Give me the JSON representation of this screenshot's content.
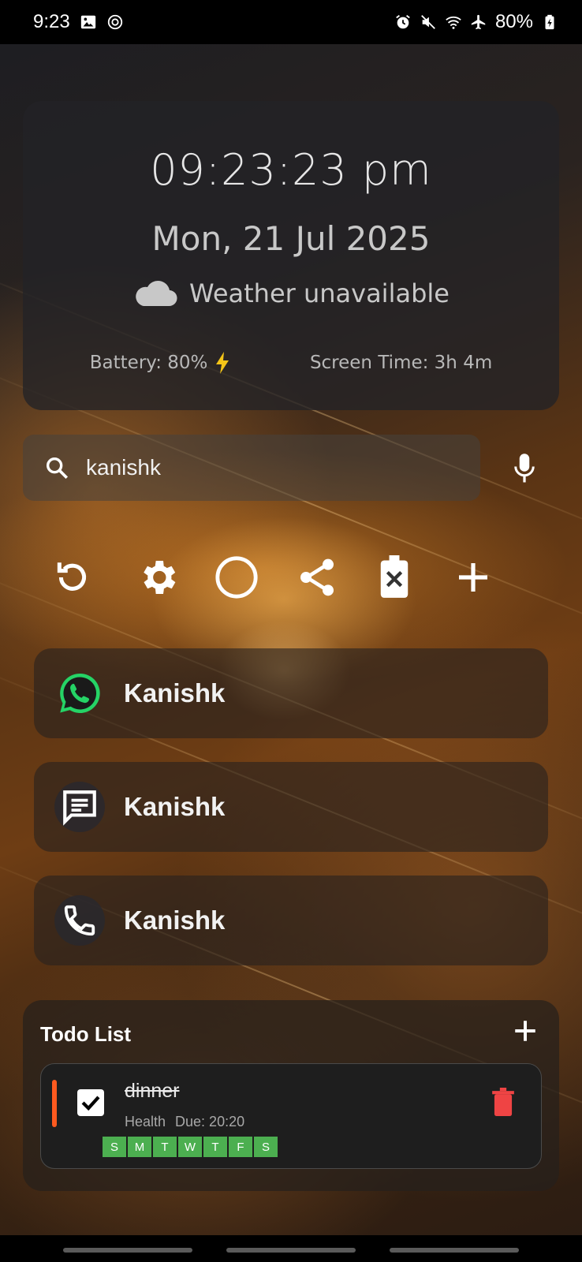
{
  "status_bar": {
    "time": "9:23",
    "battery": "80%"
  },
  "clock": {
    "time": "09:23:23 pm",
    "date": "Mon, 21 Jul 2025",
    "weather_text": "Weather unavailable",
    "battery_label": "Battery: 80%",
    "screen_time_label": "Screen Time: 3h 4m"
  },
  "search": {
    "query": "kanishk"
  },
  "quick_actions": [
    {
      "icon": "refresh-icon"
    },
    {
      "icon": "gear-icon"
    },
    {
      "icon": "circle-icon"
    },
    {
      "icon": "share-icon"
    },
    {
      "icon": "battery-off-icon"
    },
    {
      "icon": "plus-icon"
    }
  ],
  "contacts": [
    {
      "app": "whatsapp-icon",
      "name": "Kanishk"
    },
    {
      "app": "message-icon",
      "name": "Kanishk"
    },
    {
      "app": "phone-icon",
      "name": "Kanishk"
    }
  ],
  "todo": {
    "title": "Todo List",
    "items": [
      {
        "text": "dinner",
        "category": "Health",
        "due": "Due: 20:20",
        "days": [
          "S",
          "M",
          "T",
          "W",
          "T",
          "F",
          "S"
        ],
        "completed": true
      }
    ]
  },
  "colors": {
    "todo_day": "#4caf50",
    "priority": "#ff5a1f",
    "trash": "#ef4444",
    "whatsapp": "#25d366"
  }
}
